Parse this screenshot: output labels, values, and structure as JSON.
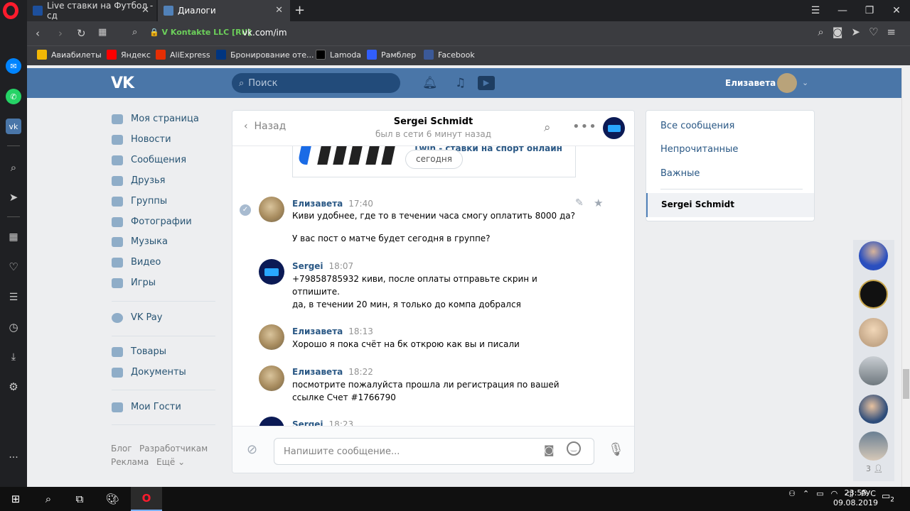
{
  "browser": {
    "tabs": [
      {
        "title": "Live ставки на Футбол - сд",
        "favicon_color": "#1d4f9c"
      },
      {
        "title": "Диалоги",
        "favicon_color": "#5181b8"
      }
    ],
    "new_tab": "+",
    "site_name": "V Kontakte LLC [RU]",
    "url": "vk.com/im",
    "bookmarks": [
      {
        "label": "Авиабилеты",
        "color": "#f2b705"
      },
      {
        "label": "Яндекс",
        "color": "#ff0000"
      },
      {
        "label": "AliExpress",
        "color": "#e62e04"
      },
      {
        "label": "Бронирование оте...",
        "color": "#003580"
      },
      {
        "label": "Lamoda",
        "color": "#000000"
      },
      {
        "label": "Рамблер",
        "color": "#315efb"
      },
      {
        "label": "Facebook",
        "color": "#3b5998"
      }
    ]
  },
  "vk": {
    "search_placeholder": "Поиск",
    "user_name": "Елизавета",
    "menu": [
      {
        "label": "Моя страница"
      },
      {
        "label": "Новости"
      },
      {
        "label": "Сообщения"
      },
      {
        "label": "Друзья"
      },
      {
        "label": "Группы"
      },
      {
        "label": "Фотографии"
      },
      {
        "label": "Музыка"
      },
      {
        "label": "Видео"
      },
      {
        "label": "Игры"
      }
    ],
    "menu2": [
      {
        "label": "VK Pay"
      }
    ],
    "menu3": [
      {
        "label": "Товары"
      },
      {
        "label": "Документы"
      }
    ],
    "menu4": [
      {
        "label": "Мои Гости"
      }
    ],
    "footer": [
      "Блог",
      "Разработчикам",
      "Реклама",
      "Ещё"
    ]
  },
  "dialog": {
    "back_label": "Назад",
    "name": "Sergei Schmidt",
    "status": "был в сети 6 минут назад",
    "snippet_title": "1win - ставки на спорт онлайн",
    "date_pill": "сегодня",
    "messages": [
      {
        "author": "Елизавета",
        "time": "17:40",
        "lines": [
          "Киви удобнее, где то в течении часа смогу оплатить 8000 да?",
          "",
          "У вас пост о матче будет сегодня в группе?"
        ]
      },
      {
        "author": "Sergei",
        "time": "18:07",
        "lines": [
          "+79858785932 киви, после оплаты отправьте скрин и",
          "отпишите.",
          "да, в течении 20 мин, я только до компа добрался"
        ]
      },
      {
        "author": "Елизавета",
        "time": "18:13",
        "lines": [
          "Хорошо я пока счёт на бк открою как вы и писали"
        ]
      },
      {
        "author": "Елизавета",
        "time": "18:22",
        "lines": [
          "посмотрите пожалуйста прошла ли регистрация по вашей",
          "ссылке Счет #1766790"
        ]
      },
      {
        "author": "Sergei",
        "time": "18:23",
        "lines": []
      }
    ],
    "composer_placeholder": "Напишите сообщение..."
  },
  "right_panel": {
    "items": [
      "Все сообщения",
      "Непрочитанные",
      "Важные"
    ],
    "selected": "Sergei Schmidt"
  },
  "chat_bubbles": {
    "more_count": "3"
  },
  "taskbar": {
    "lang": "РУС",
    "time": "23:55",
    "date": "09.08.2019",
    "notif_count": "2"
  }
}
